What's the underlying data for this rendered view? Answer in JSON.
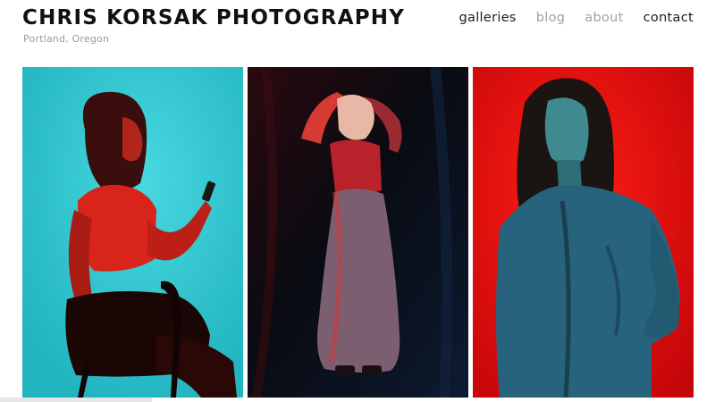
{
  "header": {
    "title": "CHRIS KORSAK PHOTOGRAPHY",
    "subtitle": "Portland, Oregon"
  },
  "nav": {
    "items": [
      {
        "label": "galleries",
        "state": "active"
      },
      {
        "label": "blog",
        "state": "muted"
      },
      {
        "label": "about",
        "state": "muted"
      },
      {
        "label": "contact",
        "state": "active"
      }
    ]
  },
  "gallery": {
    "photos": [
      {
        "subject": "woman-seated-with-phone",
        "background": "#2cc2cc",
        "light": "#e52a1e"
      },
      {
        "subject": "woman-standing-arms-raised",
        "background": "#0a0d14",
        "light": "#e0353a"
      },
      {
        "subject": "woman-portrait-red-backdrop",
        "background": "#e00b0f",
        "light": "#2d8fa3"
      }
    ]
  }
}
